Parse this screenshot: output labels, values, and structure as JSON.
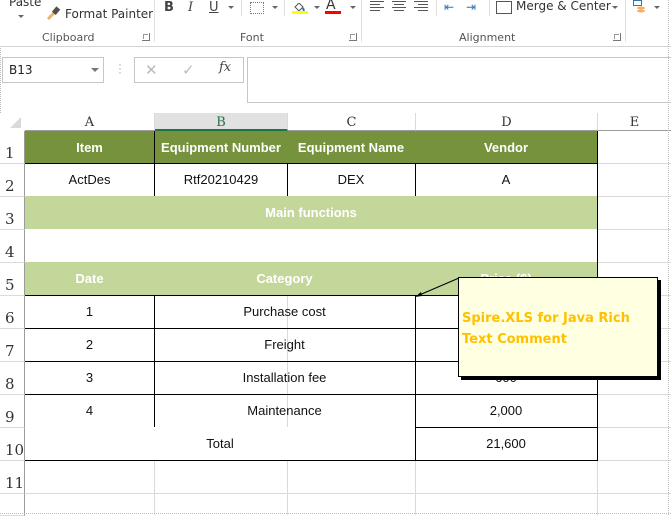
{
  "ribbon": {
    "clipboard": {
      "paste_label": "Paste",
      "format_painter_label": "Format Painter",
      "group_label": "Clipboard"
    },
    "font": {
      "bold_label": "B",
      "italic_label": "I",
      "underline_label": "U",
      "font_color_glyph": "A",
      "fill_color": "#ffff00",
      "font_color": "#ff0000",
      "group_label": "Font"
    },
    "alignment": {
      "merge_center_label": "Merge & Center",
      "group_label": "Alignment"
    }
  },
  "formula_bar": {
    "name_box": "B13",
    "cancel_glyph": "✕",
    "enter_glyph": "✓",
    "fx_label": "fx",
    "formula_value": ""
  },
  "columns": [
    "A",
    "B",
    "C",
    "D",
    "E"
  ],
  "selected_column": "B",
  "rows": [
    "1",
    "2",
    "3",
    "4",
    "5",
    "6",
    "7",
    "8",
    "9",
    "10",
    "11"
  ],
  "sheet": {
    "header_row": [
      "Item",
      "Equipment Number",
      "Equipment Name",
      "Vendor"
    ],
    "info_row": [
      "ActDes",
      "Rtf20210429",
      "DEX",
      "A"
    ],
    "section_title": "Main functions",
    "cost_headers": [
      "Date",
      "Category",
      "Price ($)"
    ],
    "cost_rows": [
      {
        "date": "1",
        "category": "Purchase cost",
        "price": ""
      },
      {
        "date": "2",
        "category": "Freight",
        "price": ""
      },
      {
        "date": "3",
        "category": "Installation fee",
        "price": "600"
      },
      {
        "date": "4",
        "category": "Maintenance",
        "price": "2,000"
      }
    ],
    "total_label": "Total",
    "total_value": "21,600"
  },
  "comment": {
    "text": "Spire.XLS for Java Rich Text Comment",
    "text_color": "#ffc000",
    "background": "#ffffe1"
  },
  "colors": {
    "header_dark": "#76923c",
    "header_light": "#c4d79b",
    "selection_accent": "#217346"
  }
}
